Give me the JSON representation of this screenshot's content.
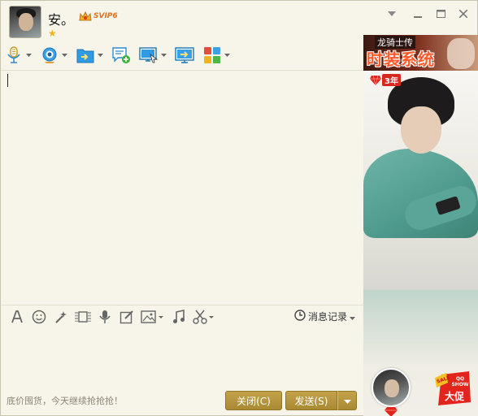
{
  "contact": {
    "name": "安。",
    "vip_label": "SVIP6"
  },
  "window_controls": [
    "dropdown",
    "minimize",
    "maximize",
    "close"
  ],
  "toolbar": {
    "items": [
      {
        "icon": "microphone-icon",
        "has_menu": true
      },
      {
        "icon": "webcam-icon",
        "has_menu": true
      },
      {
        "icon": "send-file-icon",
        "has_menu": true
      },
      {
        "icon": "new-discussion-icon",
        "has_menu": false
      },
      {
        "icon": "remote-desktop-icon",
        "has_menu": true
      },
      {
        "icon": "screen-share-icon",
        "has_menu": false
      },
      {
        "icon": "apps-icon",
        "has_menu": true
      }
    ]
  },
  "input_toolbar": {
    "items": [
      "font-icon",
      "emoji-icon",
      "magic-icon",
      "screenshot-icon",
      "voice-message-icon",
      "doodle-icon",
      "image-icon",
      "music-icon",
      "scissors-icon"
    ],
    "history_label": "消息记录"
  },
  "footer": {
    "promo_text": "底价囤货，今天继续抢抢抢！",
    "close_label": "关闭(C)",
    "send_label": "发送(S)"
  },
  "ad_banner": {
    "top_text": "龙骑士传",
    "main_text": "时装系统"
  },
  "qq_show": {
    "anniversary_label": "3年",
    "badge_text_top": "QQ SHOW",
    "badge_text_main": "大促",
    "badge_tag": "SALE"
  },
  "colors": {
    "accent_button": "#b69640",
    "window_bg": "#f7f5ea",
    "icon_blue": "#2a8fd6"
  }
}
